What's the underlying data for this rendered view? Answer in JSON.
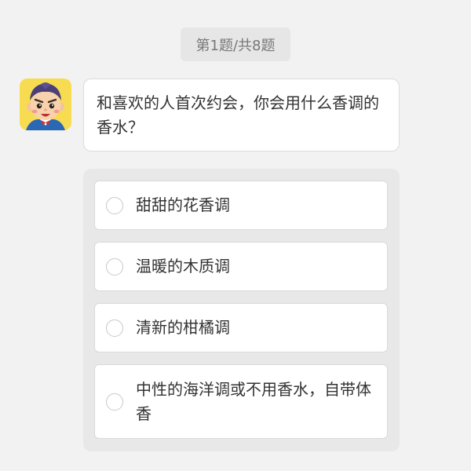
{
  "progress": {
    "label": "第1题/共8题"
  },
  "avatar": {
    "icon": "cartoon-boy-avatar-icon",
    "background_color": "#f7dc52"
  },
  "question": {
    "text": "和喜欢的人首次约会，你会用什么香调的香水？"
  },
  "options": [
    {
      "label": "甜甜的花香调",
      "selected": false
    },
    {
      "label": "温暖的木质调",
      "selected": false
    },
    {
      "label": "清新的柑橘调",
      "selected": false
    },
    {
      "label": "中性的海洋调或不用香水，自带体香",
      "selected": false
    }
  ],
  "colors": {
    "page_background": "#f2f2f2",
    "panel_background": "#e8e8e8",
    "card_background": "#ffffff",
    "text": "#333333"
  }
}
